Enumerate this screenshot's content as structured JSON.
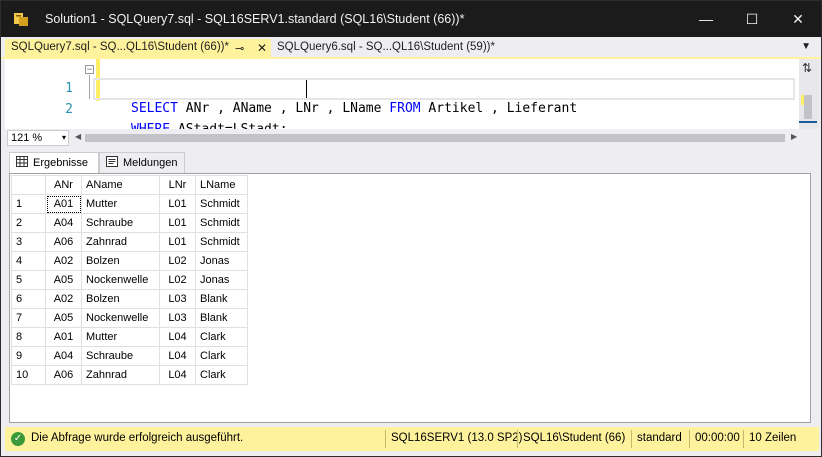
{
  "window": {
    "title": "Solution1 - SQLQuery7.sql - SQL16SERV1.standard (SQL16\\Student (66))*",
    "minimize_glyph": "—",
    "maximize_glyph": "☐",
    "close_glyph": "✕"
  },
  "tabs": [
    {
      "label": "SQLQuery7.sql - SQ...QL16\\Student (66))*",
      "active": true,
      "pin_glyph": "⊸",
      "close_glyph": "✕"
    },
    {
      "label": "SQLQuery6.sql - SQ...QL16\\Student (59))*",
      "active": false
    }
  ],
  "tab_dropdown_glyph": "▼",
  "editor": {
    "lines": [
      {
        "number": "1",
        "keyword1": "SELECT",
        "text1": " ANr , AName , LNr , LName ",
        "keyword2": "FROM",
        "text2": " Artikel , Lieferant"
      },
      {
        "number": "2",
        "keyword1": "WHERE",
        "text1": " AStadt=LStadt;",
        "keyword2": "",
        "text2": ""
      }
    ],
    "collapse_glyph": "−",
    "split_glyph": "⇅"
  },
  "zoom": {
    "value": "121 %",
    "arrow": "▾"
  },
  "result_tabs": [
    {
      "label": "Ergebnisse",
      "active": true,
      "icon": "grid-icon"
    },
    {
      "label": "Meldungen",
      "active": false,
      "icon": "messages-icon"
    }
  ],
  "grid": {
    "columns": [
      "",
      "ANr",
      "AName",
      "LNr",
      "LName"
    ],
    "rows": [
      [
        "1",
        "A01",
        "Mutter",
        "L01",
        "Schmidt"
      ],
      [
        "2",
        "A04",
        "Schraube",
        "L01",
        "Schmidt"
      ],
      [
        "3",
        "A06",
        "Zahnrad",
        "L01",
        "Schmidt"
      ],
      [
        "4",
        "A02",
        "Bolzen",
        "L02",
        "Jonas"
      ],
      [
        "5",
        "A05",
        "Nockenwelle",
        "L02",
        "Jonas"
      ],
      [
        "6",
        "A02",
        "Bolzen",
        "L03",
        "Blank"
      ],
      [
        "7",
        "A05",
        "Nockenwelle",
        "L03",
        "Blank"
      ],
      [
        "8",
        "A01",
        "Mutter",
        "L04",
        "Clark"
      ],
      [
        "9",
        "A04",
        "Schraube",
        "L04",
        "Clark"
      ],
      [
        "10",
        "A06",
        "Zahnrad",
        "L04",
        "Clark"
      ]
    ]
  },
  "status": {
    "ok_glyph": "✓",
    "message": "Die Abfrage wurde erfolgreich ausgeführt.",
    "server": "SQL16SERV1 (13.0 SP2)",
    "user": "SQL16\\Student (66)",
    "database": "standard",
    "time": "00:00:00",
    "rows": "10 Zeilen"
  },
  "colors": {
    "titlebar": "#1b1b1c",
    "active_tab": "#fff29d",
    "keyword": "#0000ff",
    "line_number": "#2b91af",
    "statusbar": "#fff29d"
  }
}
